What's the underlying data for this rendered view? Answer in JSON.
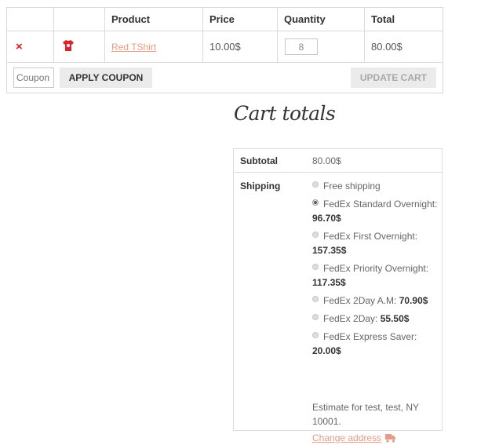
{
  "cart": {
    "headers": {
      "remove": "",
      "thumbnail": "",
      "product": "Product",
      "price": "Price",
      "quantity": "Quantity",
      "total": "Total"
    },
    "items": [
      {
        "remove_symbol": "×",
        "thumb_icon": "tshirt-icon",
        "name": "Red TShirt",
        "price": "10.00$",
        "quantity": "8",
        "total": "80.00$"
      }
    ],
    "coupon_placeholder": "Coupon",
    "apply_coupon_label": "APPLY COUPON",
    "update_cart_label": "UPDATE CART"
  },
  "totals": {
    "title": "Cart totals",
    "subtotal_label": "Subtotal",
    "subtotal_value": "80.00$",
    "shipping_label": "Shipping",
    "shipping_options": [
      {
        "label": "Free shipping",
        "price": "",
        "checked": false
      },
      {
        "label": "FedEx Standard Overnight:",
        "price": "96.70$",
        "checked": true
      },
      {
        "label": "FedEx First Overnight:",
        "price": "157.35$",
        "checked": false
      },
      {
        "label": "FedEx Priority Overnight:",
        "price": "117.35$",
        "checked": false
      },
      {
        "label": "FedEx 2Day A.M:",
        "price": "70.90$",
        "checked": false
      },
      {
        "label": "FedEx 2Day:",
        "price": "55.50$",
        "checked": false
      },
      {
        "label": "FedEx Express Saver:",
        "price": "20.00$",
        "checked": false
      }
    ],
    "estimate_text": "Estimate for test, test, NY 10001.",
    "change_address_label": "Change address",
    "change_address_icon": "truck-icon"
  },
  "colors": {
    "link": "#e59b85",
    "remove": "#e2191b",
    "button_bg": "#ebebeb"
  }
}
